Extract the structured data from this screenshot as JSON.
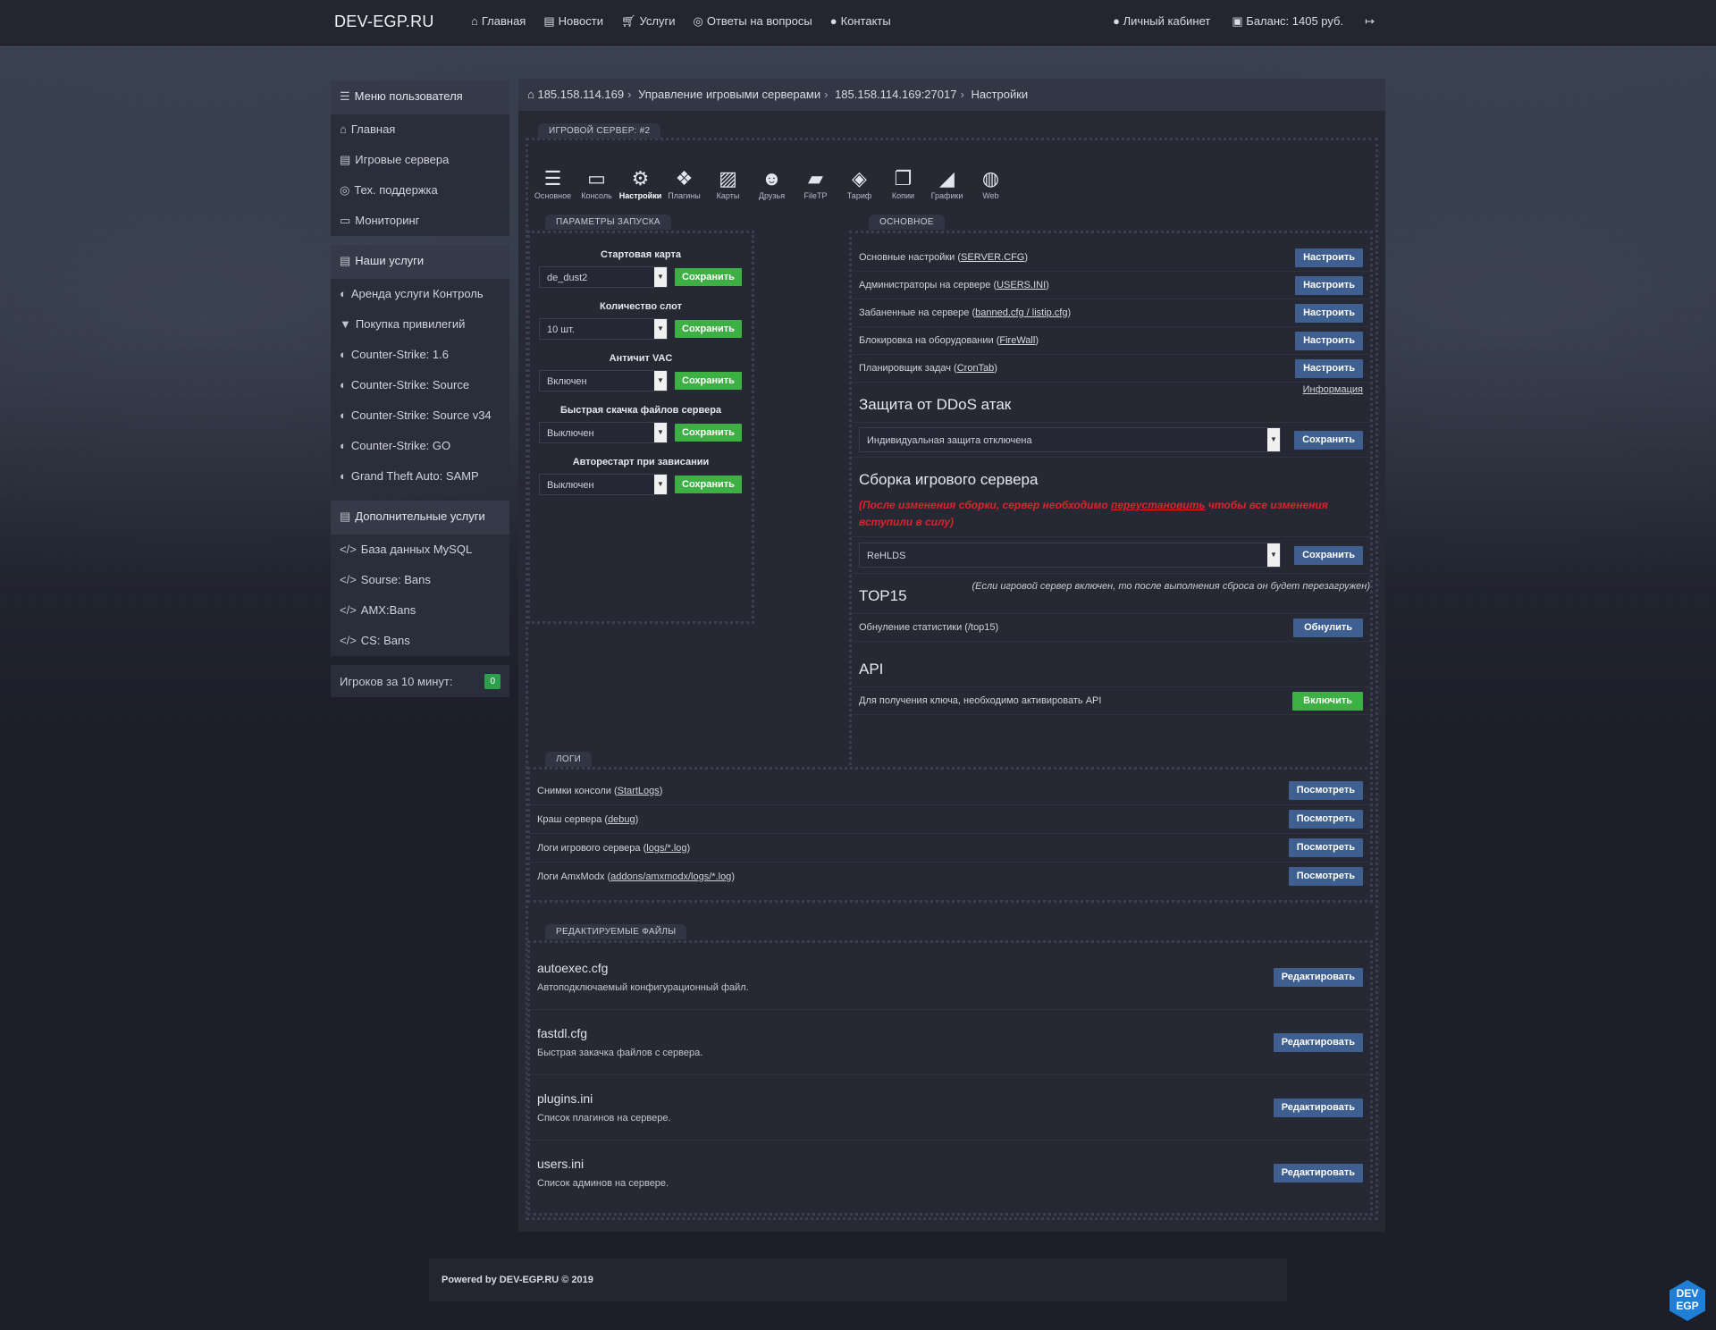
{
  "brand": "DEV-EGP.RU",
  "nav": [
    "Главная",
    "Новости",
    "Услуги",
    "Ответы на вопросы",
    "Контакты"
  ],
  "nav_right": {
    "cabinet": "Личный кабинет",
    "balance": "Баланс: 1405 руб."
  },
  "sidebar": {
    "user_menu_title": "Меню пользователя",
    "user_menu": [
      "Главная",
      "Игровые сервера",
      "Тех. поддержка",
      "Мониторинг"
    ],
    "services_title": "Наши услуги",
    "services": [
      "Аренда услуги Контроль",
      "Покупка привилегий",
      "Counter-Strike: 1.6",
      "Counter-Strike: Source",
      "Counter-Strike: Source v34",
      "Counter-Strike: GO",
      "Grand Theft Auto: SAMP"
    ],
    "extra_title": "Дополнительные услуги",
    "extra": [
      "База данных MySQL",
      "Sourse: Bans",
      "AMX:Bans",
      "CS: Bans"
    ],
    "players_label": "Игроков за 10 минут:",
    "players_count": "0"
  },
  "breadcrumb": [
    "185.158.114.169",
    "Управление игровыми серверами",
    "185.158.114.169:27017",
    "Настройки"
  ],
  "server_legend": "ИГРОВОЙ СЕРВЕР: #2",
  "toolbar": [
    "Основное",
    "Консоль",
    "Настройки",
    "Плагины",
    "Карты",
    "Друзья",
    "FileTP",
    "Тариф",
    "Копии",
    "Графики",
    "Web"
  ],
  "launch": {
    "legend": "ПАРАМЕТРЫ ЗАПУСКА",
    "save": "Сохранить",
    "params": [
      {
        "title": "Стартовая карта",
        "value": "de_dust2"
      },
      {
        "title": "Количество слот",
        "value": "10 шт."
      },
      {
        "title": "Античит VAC",
        "value": "Включен"
      },
      {
        "title": "Быстрая скачка файлов сервера",
        "value": "Выключен"
      },
      {
        "title": "Авторестарт при зависании",
        "value": "Выключен"
      }
    ]
  },
  "basic": {
    "legend": "ОСНОВНОЕ",
    "configure": "Настроить",
    "rows": [
      {
        "text": "Основные настройки (",
        "link": "SERVER.CFG",
        "end": ")"
      },
      {
        "text": "Администраторы на сервере (",
        "link": "USERS.INI",
        "end": ")"
      },
      {
        "text": "Забаненные на сервере (",
        "link": "banned.cfg / listip.cfg",
        "end": ")"
      },
      {
        "text": "Блокировка на оборудовании (",
        "link": "FireWall",
        "end": ")"
      },
      {
        "text": "Планировщик задач (",
        "link": "CronTab",
        "end": ")"
      }
    ],
    "info_link": "Информация",
    "ddos_title": "Защита от DDoS атак",
    "ddos_value": "Индивидуальная защита отключена",
    "save": "Сохранить",
    "build_title": "Сборка игрового сервера",
    "build_warn_1": "(После изменения сборки, сервер необходимо ",
    "build_warn_link": "переустановить",
    "build_warn_2": " чтобы все изменения вступили в силу)",
    "build_value": "ReHLDS",
    "top15_title": "TOP15",
    "top15_note": "(Если игровой сервер включен, то после выполнения сброса он будет перезагружен)",
    "top15_row": "Обнуление статистики (/top15)",
    "top15_btn": "Обнулить",
    "api_title": "API",
    "api_row": "Для получения ключа, необходимо активировать API",
    "api_btn": "Включить"
  },
  "logs": {
    "legend": "ЛОГИ",
    "view": "Посмотреть",
    "rows": [
      {
        "text": "Снимки консоли (",
        "link": "StartLogs",
        "end": ")"
      },
      {
        "text": "Краш сервера (",
        "link": "debug",
        "end": ")"
      },
      {
        "text": "Логи игрового сервера (",
        "link": "logs/*.log",
        "end": ")"
      },
      {
        "text": "Логи AmxModx (",
        "link": "addons/amxmodx/logs/*.log",
        "end": ")"
      }
    ]
  },
  "files": {
    "legend": "РЕДАКТИРУЕМЫЕ ФАЙЛЫ",
    "edit": "Редактировать",
    "rows": [
      {
        "name": "autoexec.cfg",
        "desc": "Автоподключаемый конфигурационный файл."
      },
      {
        "name": "fastdl.cfg",
        "desc": "Быстрая закачка файлов с сервера."
      },
      {
        "name": "plugins.ini",
        "desc": "Список плагинов на сервере."
      },
      {
        "name": "users.ini",
        "desc": "Список админов на сервере."
      }
    ]
  },
  "footer": "Powered by DEV-EGP.RU © 2019",
  "badge": [
    "DEV",
    "EGP"
  ]
}
